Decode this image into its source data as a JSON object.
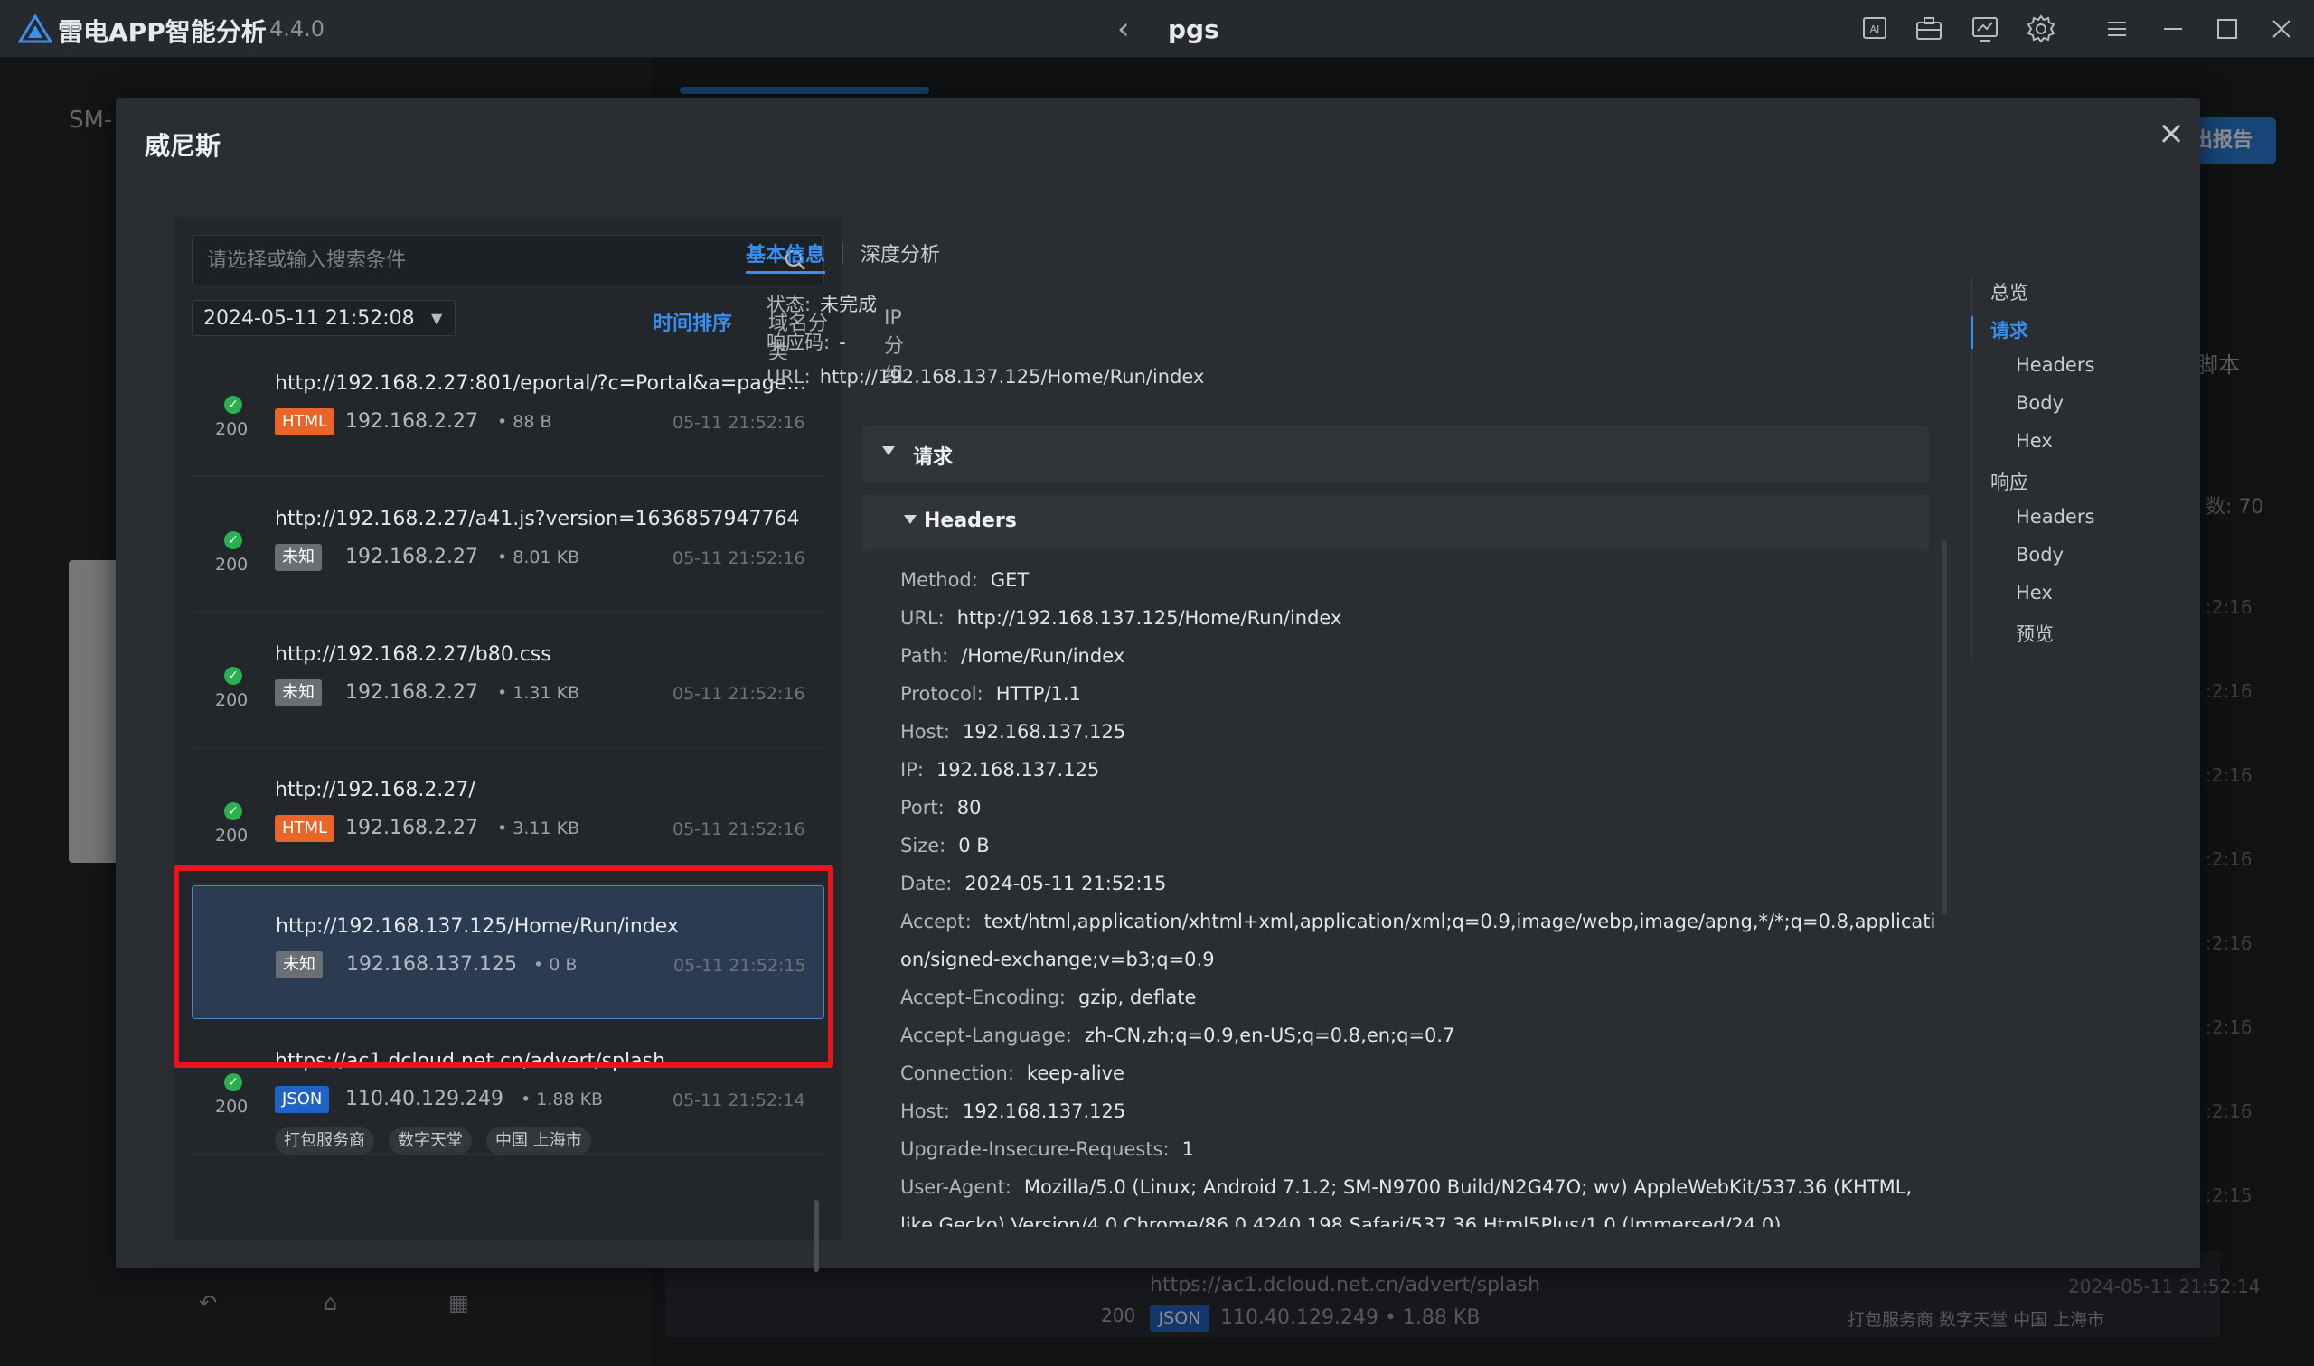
{
  "app": {
    "title": "雷电APP智能分析",
    "version": "4.4.0",
    "window_title": "pgs",
    "toolbar_icons": [
      "ai-icon",
      "toolbox-icon",
      "monitor-icon",
      "gear-icon",
      "menu-icon",
      "minimize-icon",
      "maximize-icon",
      "close-icon"
    ]
  },
  "background": {
    "device_label": "SM-",
    "export_button": "出报告",
    "script_label": "脚本",
    "count_label": "数: 70",
    "times": [
      ":2:16",
      ":2:16",
      ":2:16",
      ":2:16",
      ":2:16",
      ":2:16",
      ":2:16",
      ":2:15"
    ],
    "bottom_row": {
      "url": "https://ac1.dcloud.net.cn/advert/splash",
      "time": "2024-05-11 21:52:14",
      "status": "200",
      "type": "JSON",
      "ip": "110.40.129.249",
      "size": "1.88 KB",
      "tags": "打包服务商   数字天堂   中国 上海市"
    }
  },
  "modal": {
    "title": "威尼斯",
    "search": {
      "placeholder": "请选择或输入搜索条件"
    },
    "date_filter": "2024-05-11 21:52:08",
    "sort_tabs": [
      {
        "label": "时间排序",
        "active": true
      },
      {
        "label": "域名分类",
        "active": false
      },
      {
        "label": "IP分组",
        "active": false
      }
    ],
    "requests": [
      {
        "status": "200",
        "url": "http://192.168.2.27:801/eportal/?c=Portal&a=page_typ...",
        "type": "HTML",
        "host": "192.168.2.27",
        "size": "88 B",
        "time": "05-11 21:52:16",
        "tags": []
      },
      {
        "status": "200",
        "url": "http://192.168.2.27/a41.js?version=1636857947764",
        "type": "未知",
        "host": "192.168.2.27",
        "size": "8.01 KB",
        "time": "05-11 21:52:16",
        "tags": []
      },
      {
        "status": "200",
        "url": "http://192.168.2.27/b80.css",
        "type": "未知",
        "host": "192.168.2.27",
        "size": "1.31 KB",
        "time": "05-11 21:52:16",
        "tags": []
      },
      {
        "status": "200",
        "url": "http://192.168.2.27/",
        "type": "HTML",
        "host": "192.168.2.27",
        "size": "3.11 KB",
        "time": "05-11 21:52:16",
        "tags": []
      },
      {
        "status": "",
        "url": "http://192.168.137.125/Home/Run/index",
        "type": "未知",
        "host": "192.168.137.125",
        "size": "0 B",
        "time": "05-11 21:52:15",
        "tags": []
      },
      {
        "status": "200",
        "url": "https://ac1.dcloud.net.cn/advert/splash",
        "type": "JSON",
        "host": "110.40.129.249",
        "size": "1.88 KB",
        "time": "05-11 21:52:14",
        "tags": [
          "打包服务商",
          "数字天堂",
          "中国 上海市"
        ]
      }
    ],
    "detail": {
      "tabs": [
        "基本信息",
        "深度分析"
      ],
      "status_label": "状态:",
      "status_value": "未完成",
      "code_label": "响应码:",
      "code_value": "-",
      "url_label": "URL:",
      "url_value": "http://192.168.137.125/Home/Run/index",
      "section_request": "请求",
      "section_headers": "Headers",
      "headers": [
        {
          "k": "Method:",
          "v": "GET"
        },
        {
          "k": "URL:",
          "v": "http://192.168.137.125/Home/Run/index"
        },
        {
          "k": "Path:",
          "v": "/Home/Run/index"
        },
        {
          "k": "Protocol:",
          "v": "HTTP/1.1"
        },
        {
          "k": "Host:",
          "v": "192.168.137.125"
        },
        {
          "k": "IP:",
          "v": "192.168.137.125"
        },
        {
          "k": "Port:",
          "v": "80"
        },
        {
          "k": "Size:",
          "v": "0 B"
        },
        {
          "k": "Date:",
          "v": "2024-05-11 21:52:15"
        },
        {
          "k": "Accept:",
          "v": "text/html,application/xhtml+xml,application/xml;q=0.9,image/webp,image/apng,*/*;q=0.8,applicati"
        },
        {
          "k": "",
          "v": "on/signed-exchange;v=b3;q=0.9"
        },
        {
          "k": "Accept-Encoding:",
          "v": "gzip, deflate"
        },
        {
          "k": "Accept-Language:",
          "v": "zh-CN,zh;q=0.9,en-US;q=0.8,en;q=0.7"
        },
        {
          "k": "Connection:",
          "v": "keep-alive"
        },
        {
          "k": "Host:",
          "v": "192.168.137.125"
        },
        {
          "k": "Upgrade-Insecure-Requests:",
          "v": "1"
        },
        {
          "k": "User-Agent:",
          "v": "Mozilla/5.0 (Linux; Android 7.1.2; SM-N9700 Build/N2G47O; wv) AppleWebKit/537.36 (KHTML,"
        },
        {
          "k": "",
          "v": "like Gecko) Version/4.0 Chrome/86.0.4240.198 Safari/537.36 Html5Plus/1.0 (Immersed/24.0)"
        }
      ]
    },
    "outline": [
      {
        "label": "总览",
        "sub": false,
        "active": false
      },
      {
        "label": "请求",
        "sub": false,
        "active": true
      },
      {
        "label": "Headers",
        "sub": true,
        "active": false
      },
      {
        "label": "Body",
        "sub": true,
        "active": false
      },
      {
        "label": "Hex",
        "sub": true,
        "active": false
      },
      {
        "label": "响应",
        "sub": false,
        "active": false
      },
      {
        "label": "Headers",
        "sub": true,
        "active": false
      },
      {
        "label": "Body",
        "sub": true,
        "active": false
      },
      {
        "label": "Hex",
        "sub": true,
        "active": false
      },
      {
        "label": "预览",
        "sub": true,
        "active": false
      }
    ]
  },
  "colors": {
    "accent": "#3a8ef0",
    "highlight": "#e8161c",
    "html_badge": "#e8662a",
    "json_badge": "#1f64c4",
    "ok": "#2bb04f"
  }
}
